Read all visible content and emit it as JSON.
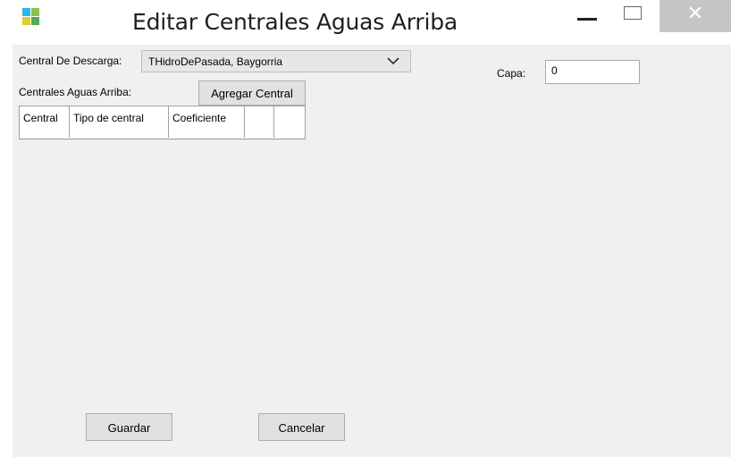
{
  "window": {
    "title": "Editar Centrales Aguas Arriba",
    "minimize_icon": "minimize-icon",
    "maximize_icon": "maximize-icon",
    "close_icon": "close-icon",
    "close_glyph": "✕"
  },
  "app_icon": {
    "name": "app-icon",
    "colors": [
      "#2cb5e8",
      "#e8c82c",
      "#4caf50",
      "#8bc34a"
    ]
  },
  "form": {
    "central_descarga_label": "Central De Descarga:",
    "central_descarga_value": "THidroDePasada, Baygorria",
    "centrales_aguas_arriba_label": "Centrales Aguas Arriba:",
    "agregar_central_label": "Agregar Central",
    "capa_label": "Capa:",
    "capa_value": "0",
    "table": {
      "columns": [
        "Central",
        "Tipo de central",
        "Coeficiente",
        "",
        ""
      ],
      "rows": []
    },
    "guardar_label": "Guardar",
    "cancelar_label": "Cancelar"
  },
  "colors": {
    "form_background": "#f0f0f0",
    "button_background": "#e1e1e1",
    "close_button": "#c5c5c5"
  }
}
